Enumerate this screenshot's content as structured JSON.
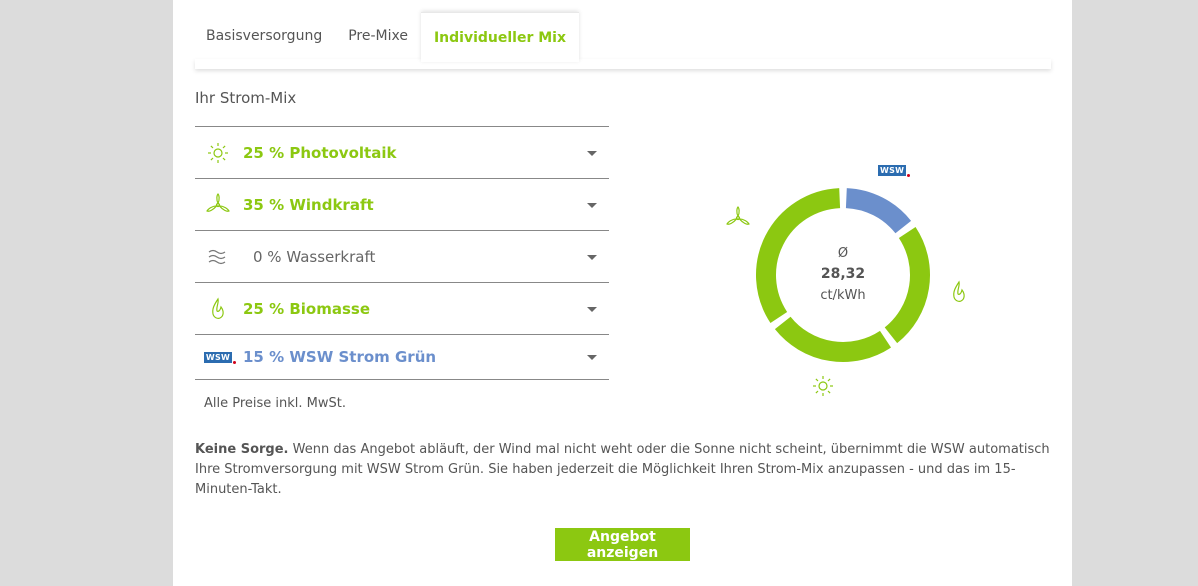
{
  "tabs": [
    {
      "label": "Basisversorgung",
      "active": false
    },
    {
      "label": "Pre-Mixe",
      "active": false
    },
    {
      "label": "Individueller Mix",
      "active": true
    }
  ],
  "mix": {
    "title": "Ihr Strom-Mix",
    "items": [
      {
        "label": "25 % Photovoltaik",
        "icon": "sun-icon",
        "percent": 25
      },
      {
        "label": "35 % Windkraft",
        "icon": "wind-turbine-icon",
        "percent": 35
      },
      {
        "label": "0 % Wasserkraft",
        "icon": "water-waves-icon",
        "percent": 0
      },
      {
        "label": "25 % Biomasse",
        "icon": "flame-leaf-icon",
        "percent": 25
      },
      {
        "label": "15 % WSW Strom Grün",
        "icon": "wsw-logo-icon",
        "percent": 15
      }
    ]
  },
  "wsw_logo_text": "WSW",
  "prices_note": "Alle Preise inkl. MwSt.",
  "price": {
    "symbol": "Ø",
    "value": "28,32",
    "unit": "ct/kWh"
  },
  "info": {
    "bold": "Keine Sorge.",
    "text": " Wenn das Angebot abläuft, der Wind mal nicht weht oder die Sonne nicht scheint, übernimmt die WSW automatisch Ihre Stromversorgung mit WSW Strom Grün. Sie haben jederzeit die Möglichkeit Ihren Strom-Mix anzupassen - und das im 15-Minuten-Takt."
  },
  "cta_label": "Angebot anzeigen",
  "colors": {
    "green": "#8cc811",
    "blue": "#6b8fcc",
    "text": "#555555"
  }
}
